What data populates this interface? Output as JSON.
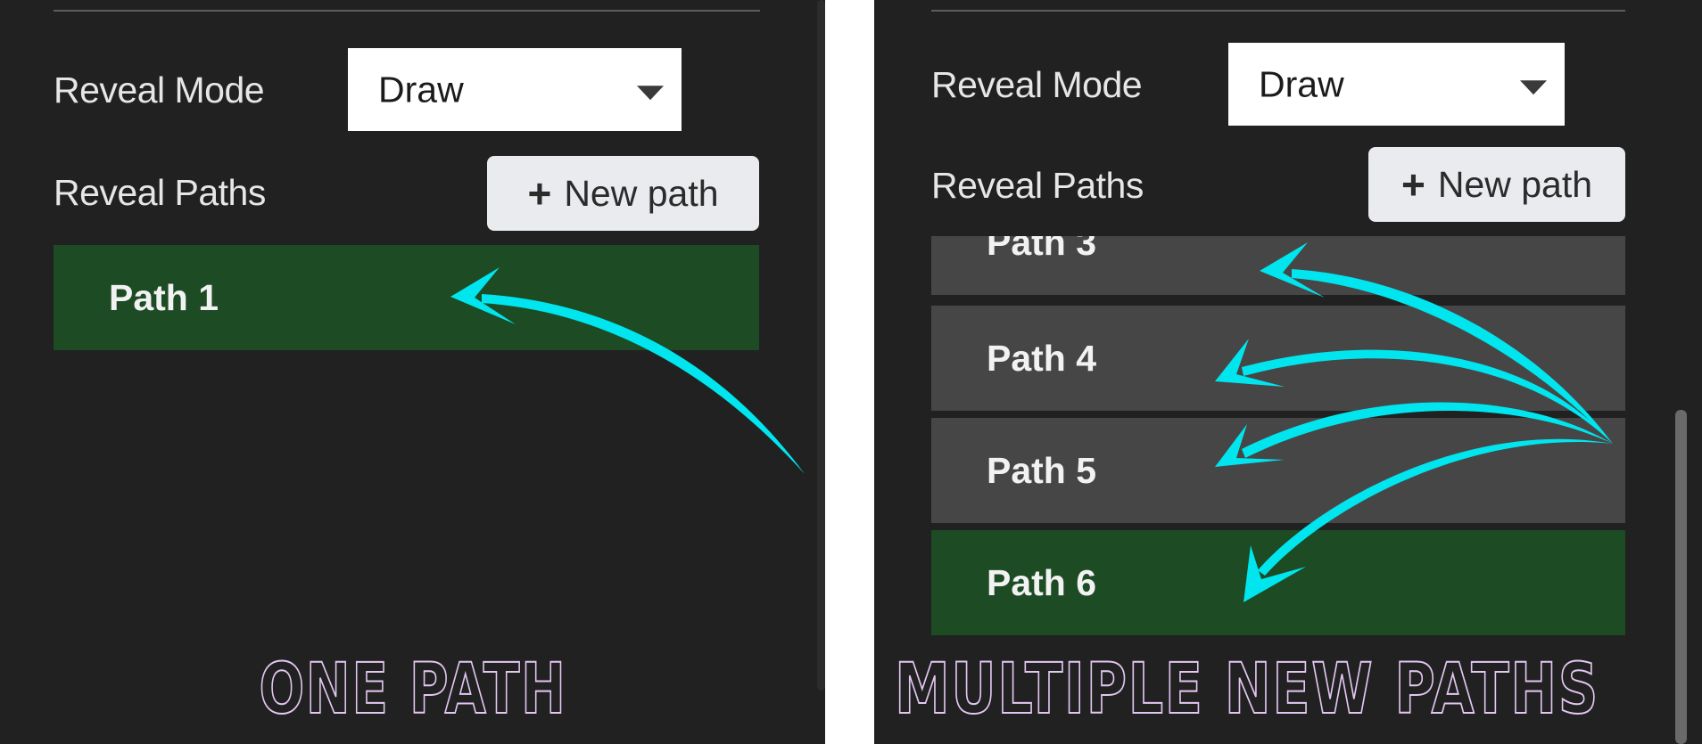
{
  "panels": [
    {
      "reveal_mode": {
        "label": "Reveal Mode",
        "value": "Draw"
      },
      "reveal_paths": {
        "label": "Reveal Paths",
        "new_path_button": "New path"
      },
      "paths": [
        {
          "label": "Path 1",
          "selected": true
        }
      ],
      "caption": "ONE PATH"
    },
    {
      "reveal_mode": {
        "label": "Reveal Mode",
        "value": "Draw"
      },
      "reveal_paths": {
        "label": "Reveal Paths",
        "new_path_button": "New path"
      },
      "paths": [
        {
          "label": "Path 3",
          "selected": false
        },
        {
          "label": "Path 4",
          "selected": false
        },
        {
          "label": "Path 5",
          "selected": false
        },
        {
          "label": "Path 6",
          "selected": true
        }
      ],
      "caption": "MULTIPLE NEW PATHS"
    }
  ],
  "colors": {
    "panel_bg": "#212121",
    "selected_row": "#1c4b24",
    "row": "#464646",
    "annotation_arrow": "#00e5ee",
    "caption_outline": "#e3c7f2"
  },
  "icons": {
    "plus": "plus-icon",
    "dropdown": "caret-down-icon"
  }
}
